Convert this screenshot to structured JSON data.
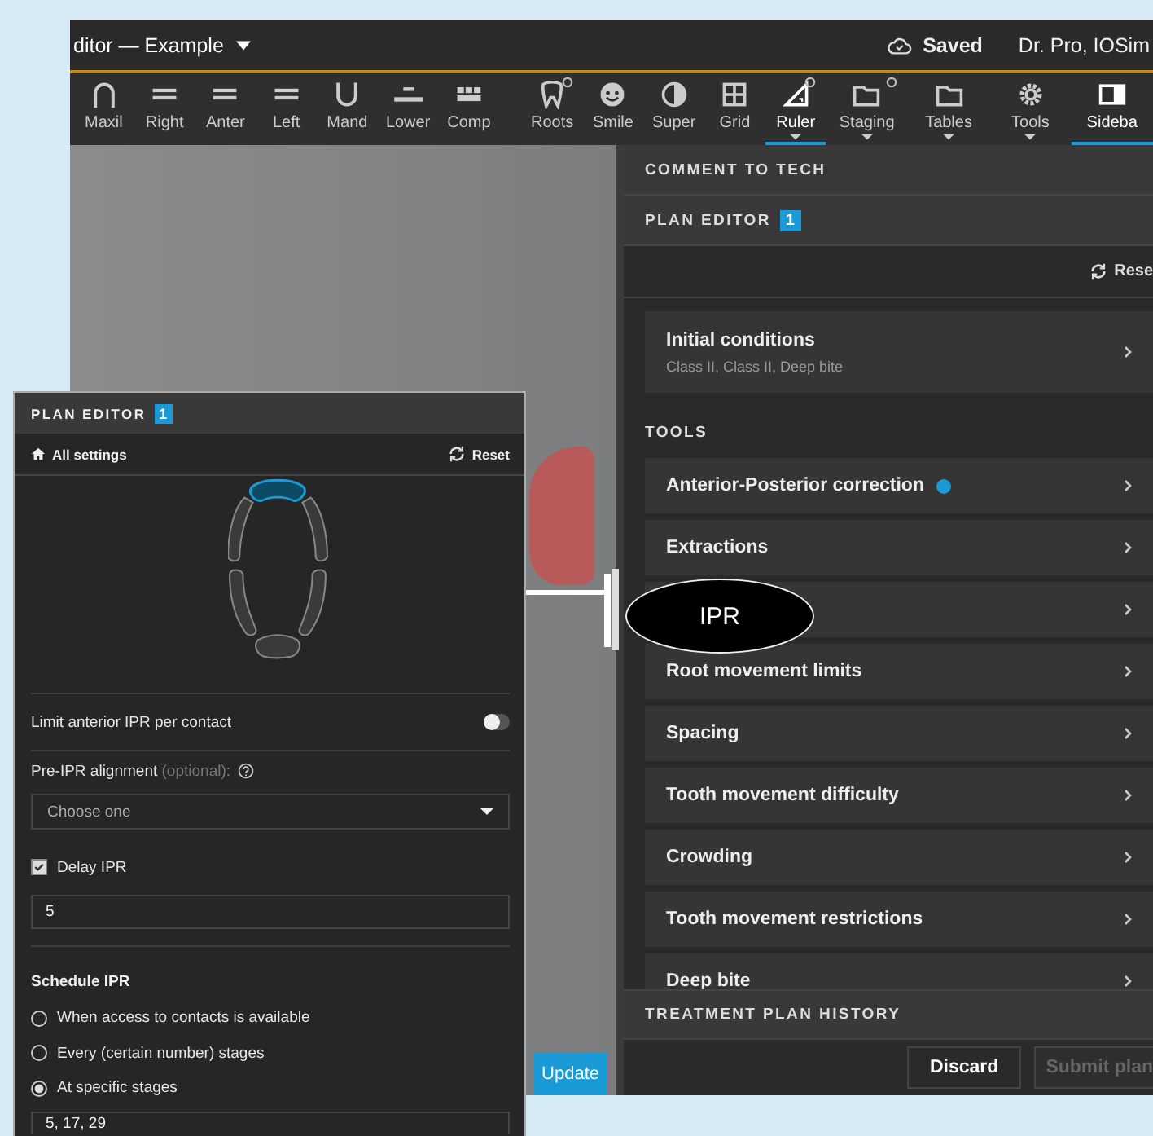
{
  "window": {
    "title": "ditor — Example",
    "save_status": "Saved",
    "user": "Dr. Pro, IOSim"
  },
  "toolbar": [
    {
      "label": "Maxil",
      "selected": false,
      "badge": false,
      "dropdown": false
    },
    {
      "label": "Right",
      "selected": false,
      "badge": false,
      "dropdown": false
    },
    {
      "label": "Anter",
      "selected": false,
      "badge": false,
      "dropdown": false
    },
    {
      "label": "Left",
      "selected": false,
      "badge": false,
      "dropdown": false
    },
    {
      "label": "Mand",
      "selected": false,
      "badge": false,
      "dropdown": false
    },
    {
      "label": "Lower",
      "selected": false,
      "badge": false,
      "dropdown": false
    },
    {
      "label": "Comp",
      "selected": false,
      "badge": false,
      "dropdown": false
    },
    {
      "label": "Roots",
      "selected": false,
      "badge": true,
      "dropdown": false
    },
    {
      "label": "Smile",
      "selected": false,
      "badge": false,
      "dropdown": false
    },
    {
      "label": "Super",
      "selected": false,
      "badge": false,
      "dropdown": false
    },
    {
      "label": "Grid",
      "selected": false,
      "badge": false,
      "dropdown": false
    },
    {
      "label": "Ruler",
      "selected": true,
      "badge": true,
      "dropdown": true
    },
    {
      "label": "Staging",
      "selected": false,
      "badge": true,
      "dropdown": true
    },
    {
      "label": "Tables",
      "selected": false,
      "badge": false,
      "dropdown": true
    },
    {
      "label": "Tools",
      "selected": false,
      "badge": false,
      "dropdown": true
    },
    {
      "label": "Sideba",
      "selected": true,
      "badge": false,
      "dropdown": false
    }
  ],
  "viewport": {
    "update_button": "Update"
  },
  "sidebar": {
    "comment_header": "COMMENT TO TECH",
    "plan_editor_header": "PLAN EDITOR",
    "plan_editor_count": "1",
    "reset": "Rese",
    "initial_conditions": {
      "title": "Initial conditions",
      "subtitle": "Class II, Class II, Deep bite"
    },
    "tools_header": "TOOLS",
    "tools": [
      {
        "label": "Anterior-Posterior correction",
        "modified": true
      },
      {
        "label": "Extractions",
        "modified": false
      },
      {
        "modified": false
      },
      {
        "label": "Root movement limits",
        "modified": false
      },
      {
        "label": "Spacing",
        "modified": false
      },
      {
        "label": "Tooth movement difficulty",
        "modified": false
      },
      {
        "label": "Crowding",
        "modified": false
      },
      {
        "label": "Tooth movement restrictions",
        "modified": false
      },
      {
        "label": "Deep bite",
        "modified": false
      }
    ],
    "history_header": "TREATMENT PLAN HISTORY",
    "buttons": [
      {
        "label": "Discard",
        "disabled": false
      },
      {
        "label": "Submit plan",
        "disabled": true
      }
    ]
  },
  "callout": {
    "label": "IPR"
  },
  "floating_panel": {
    "header": "PLAN EDITOR",
    "count": "1",
    "all_settings": "All settings",
    "reset": "Reset",
    "limit_toggle": {
      "label": "Limit anterior IPR per contact",
      "on": false
    },
    "pre_ipr": {
      "label": "Pre-IPR alignment",
      "optional": "(optional):",
      "placeholder": "Choose one"
    },
    "delay": {
      "label": "Delay IPR",
      "checked": true,
      "value": "5"
    },
    "schedule_header": "Schedule IPR",
    "schedule_options": [
      {
        "label": "When access to contacts is available",
        "selected": false
      },
      {
        "label": "Every (certain number) stages",
        "selected": false
      },
      {
        "label": "At specific stages",
        "selected": true
      }
    ],
    "stages_value": "5, 17, 29"
  }
}
